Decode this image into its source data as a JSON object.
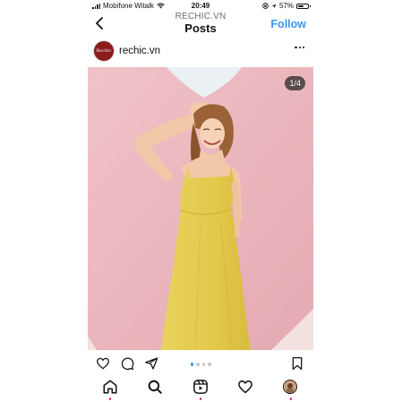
{
  "status_bar": {
    "carrier": "Mobifone Witalk",
    "time": "20:49",
    "battery_text": "57%",
    "battery_level": 0.57,
    "signal_icon": "signal-bars-icon",
    "wifi_icon": "wifi-icon",
    "location_icon": "location-arrow-icon",
    "lock_icon": "rotation-lock-icon"
  },
  "header": {
    "account": "RECHIC.VN",
    "title": "Posts",
    "follow_label": "Follow",
    "back_icon": "chevron-left-icon"
  },
  "post": {
    "avatar_text": "Rechic",
    "username": "rechic.vn",
    "more_icon": "more-horizontal-icon",
    "image_counter": "1/4",
    "carousel_total": 4,
    "carousel_active": 1
  },
  "colors": {
    "accent": "#3897f0",
    "notification_dot": "#e0245e",
    "avatar_bg": "#8b1c1c",
    "photo_wall": "#eab5bd",
    "dress": "#e6cf52"
  },
  "actions": {
    "like_icon": "heart-icon",
    "comment_icon": "comment-icon",
    "share_icon": "send-icon",
    "save_icon": "bookmark-icon"
  },
  "tabbar": {
    "items": [
      "home-icon",
      "search-icon",
      "reels-icon",
      "activity-heart-icon",
      "profile-avatar-icon"
    ]
  }
}
